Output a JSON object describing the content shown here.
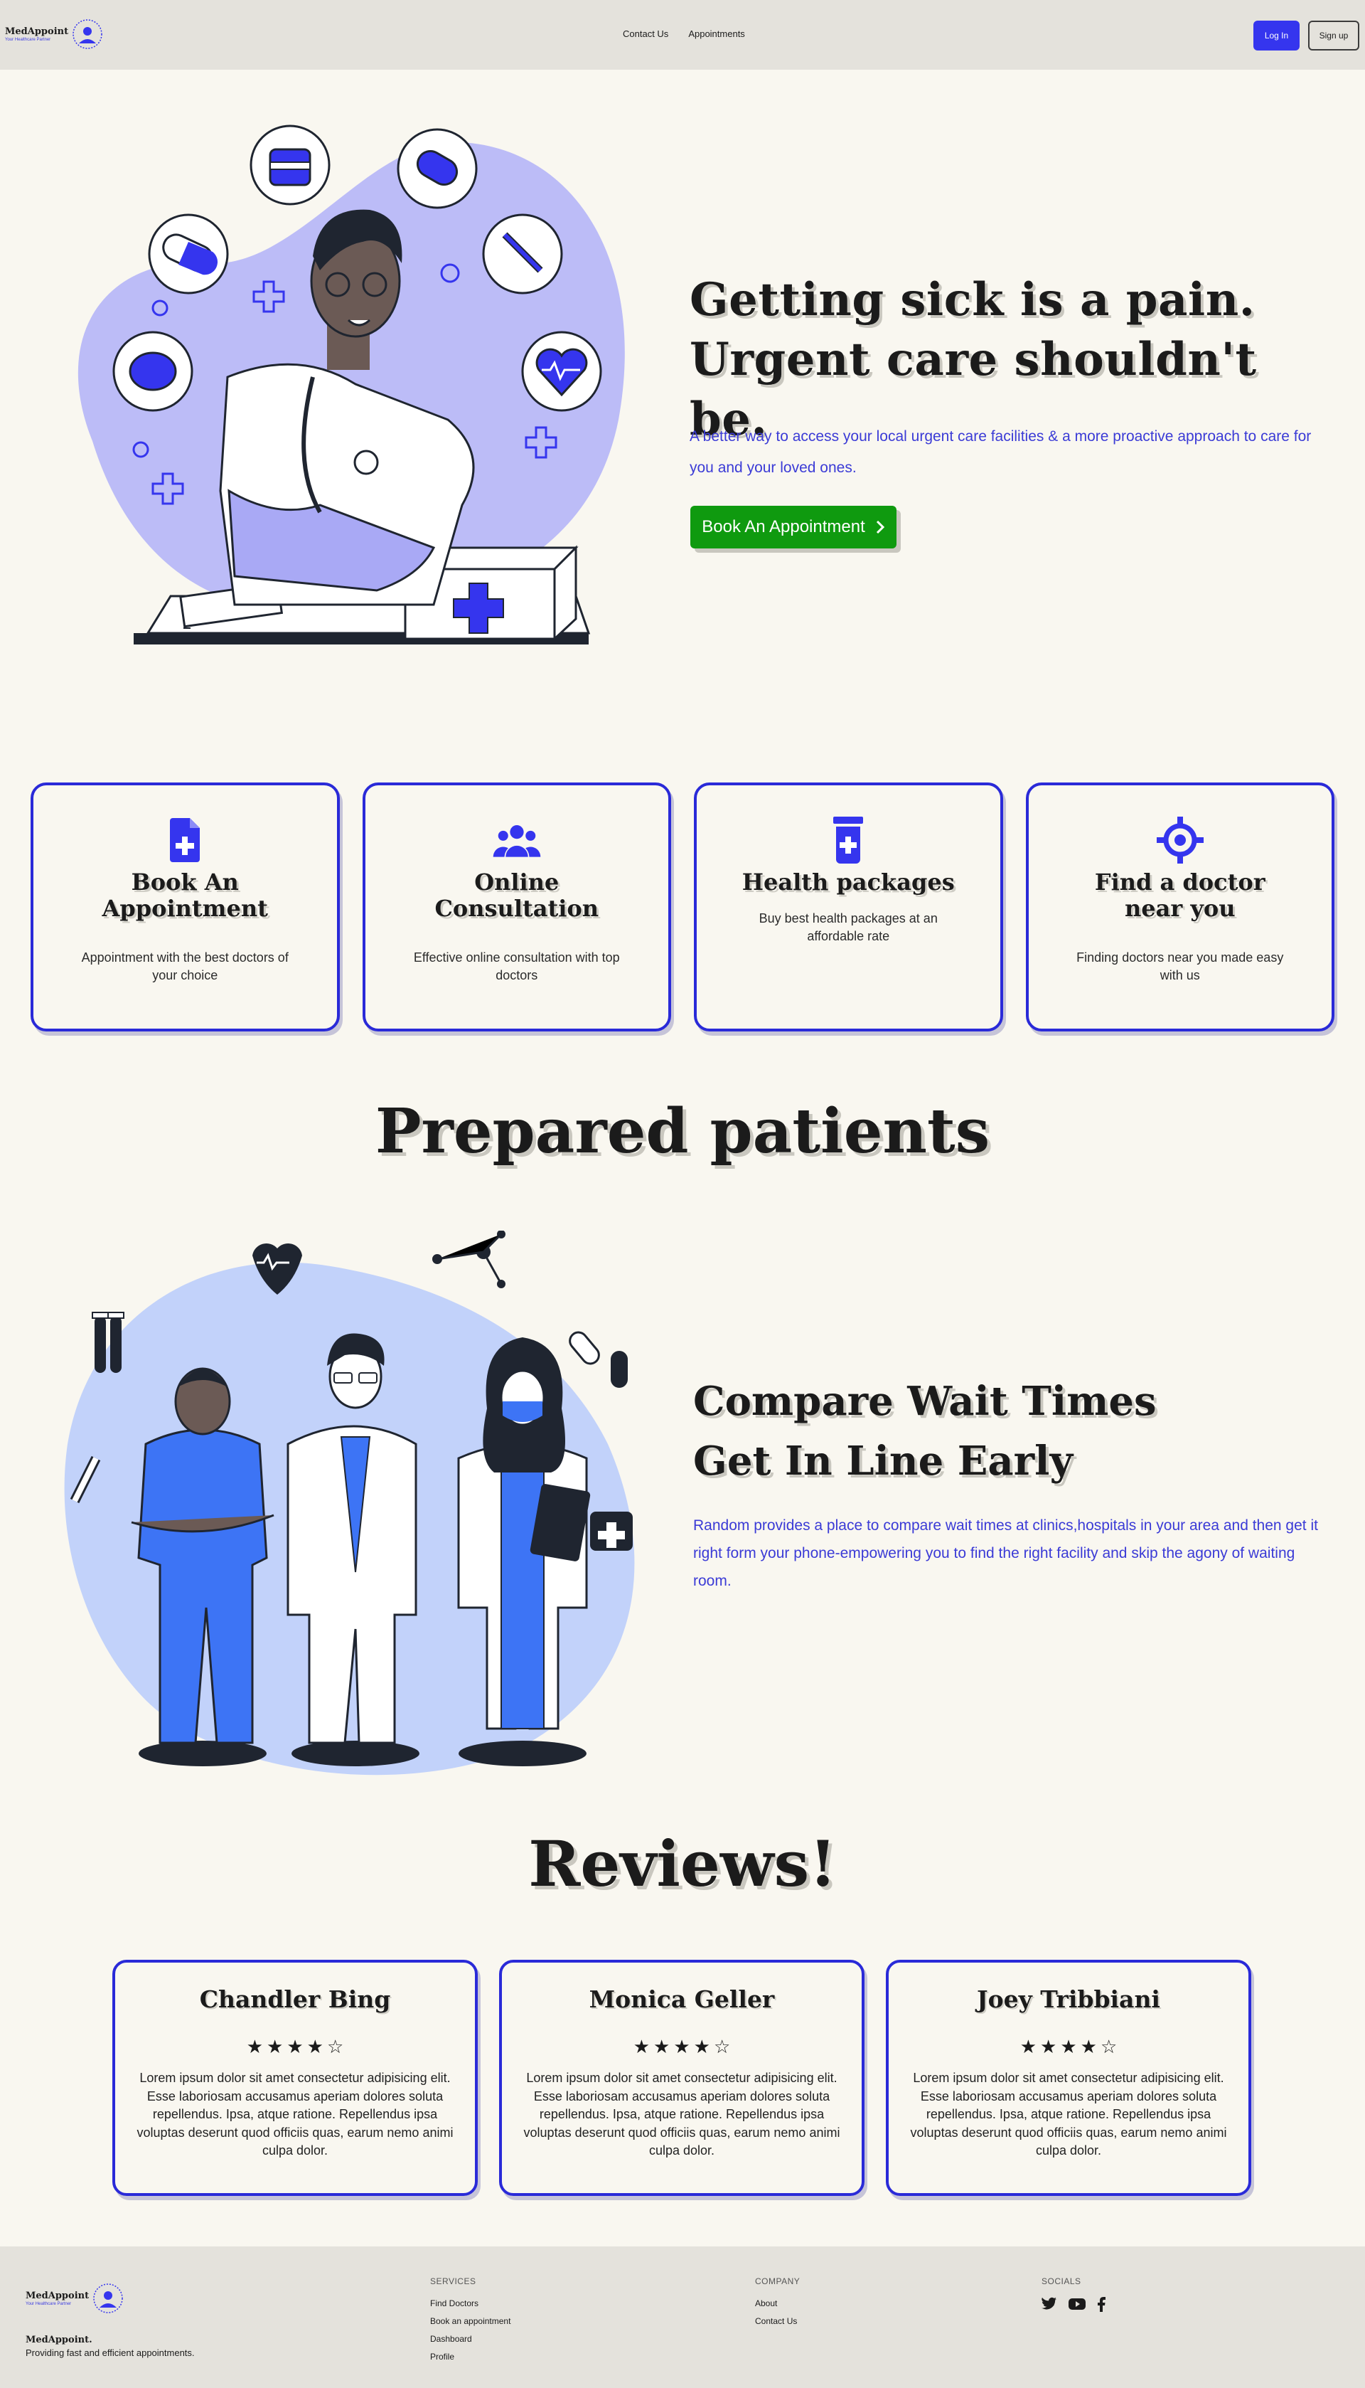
{
  "brand": {
    "name": "MedAppoint",
    "tagline": "Your Healthcare Partner"
  },
  "nav": {
    "links": [
      "Contact Us",
      "Appointments"
    ],
    "login": "Log In",
    "signup": "Sign up"
  },
  "hero": {
    "title_line1": "Getting sick is a pain.",
    "title_line2": "Urgent care shouldn't be.",
    "text": "A better way to access your local urgent care facilities & a more proactive approach to care for you and your loved ones.",
    "cta": "Book An Appointment"
  },
  "features": [
    {
      "icon": "file-plus-icon",
      "title": "Book An Appointment",
      "desc": "Appointment with the best doctors of your choice"
    },
    {
      "icon": "users-icon",
      "title": "Online Consultation",
      "desc": "Effective online consultation with top doctors"
    },
    {
      "icon": "prescription-bottle-icon",
      "title": "Health packages",
      "desc": "Buy best health packages at an affordable rate"
    },
    {
      "icon": "crosshair-icon",
      "title": "Find a doctor near you",
      "desc": "Finding doctors near you made easy with us"
    }
  ],
  "prepared": {
    "heading": "Prepared patients",
    "title_line1": "Compare Wait Times",
    "title_line2": "Get In Line Early",
    "text": "Random provides a place to compare wait times at clinics,hospitals in your area and then get it right form your phone-empowering you to find the right facility and skip the agony of waiting room."
  },
  "reviews": {
    "heading": "Reviews!",
    "items": [
      {
        "name": "Chandler Bing",
        "rating": 4.5,
        "text": "Lorem ipsum dolor sit amet consectetur adipisicing elit. Esse laboriosam accusamus aperiam dolores soluta repellendus. Ipsa, atque ratione. Repellendus ipsa voluptas deserunt quod officiis quas, earum nemo animi culpa dolor."
      },
      {
        "name": "Monica Geller",
        "rating": 4.5,
        "text": "Lorem ipsum dolor sit amet consectetur adipisicing elit. Esse laboriosam accusamus aperiam dolores soluta repellendus. Ipsa, atque ratione. Repellendus ipsa voluptas deserunt quod officiis quas, earum nemo animi culpa dolor."
      },
      {
        "name": "Joey Tribbiani",
        "rating": 4.5,
        "text": "Lorem ipsum dolor sit amet consectetur adipisicing elit. Esse laboriosam accusamus aperiam dolores soluta repellendus. Ipsa, atque ratione. Repellendus ipsa voluptas deserunt quod officiis quas, earum nemo animi culpa dolor."
      }
    ]
  },
  "footer": {
    "brand_name": "MedAppoint.",
    "brand_desc": "Providing fast and efficient appointments.",
    "services": {
      "heading": "SERVICES",
      "links": [
        "Find Doctors",
        "Book an appointment",
        "Dashboard",
        "Profile"
      ]
    },
    "company": {
      "heading": "COMPANY",
      "links": [
        "About",
        "Contact Us"
      ]
    },
    "socials": {
      "heading": "SOCIALS",
      "icons": [
        "twitter-icon",
        "youtube-icon",
        "facebook-icon"
      ]
    }
  },
  "colors": {
    "accent": "#3535ee",
    "cta": "#0f9a0f",
    "blob": "#bcbcf7",
    "blob2": "#c2d2fa",
    "text_blue": "#3b3bd6",
    "bg": "#f9f7f0",
    "nav_bg": "#e4e2dc"
  }
}
